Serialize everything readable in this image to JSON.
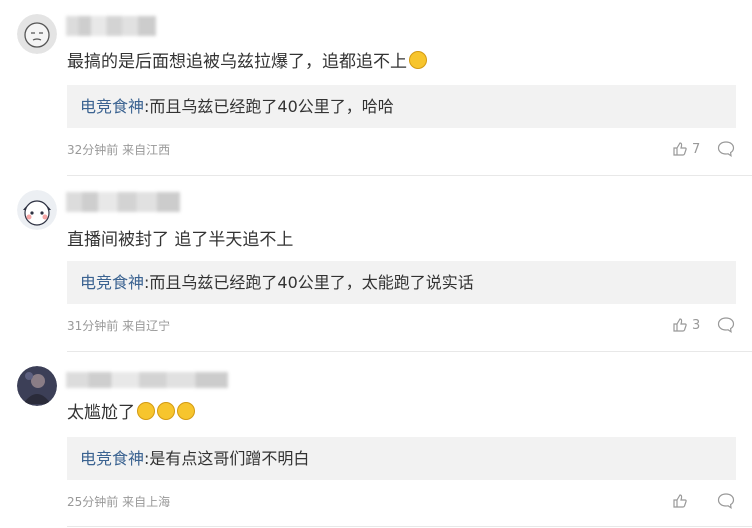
{
  "comments": [
    {
      "avatar_icon": "face-sketch-icon",
      "text": "最搞的是后面想追被乌兹拉爆了，追都追不上",
      "emojis": [
        "doge-emoji"
      ],
      "reply": {
        "name": "电竞食神",
        "text": ":而且乌兹已经跑了40公里了，哈哈"
      },
      "meta": "32分钟前 来自江西",
      "likes": "7"
    },
    {
      "avatar_icon": "cartoon-face-icon",
      "text": "直播间被封了 追了半天追不上",
      "emojis": [],
      "reply": {
        "name": "电竞食神",
        "text": ":而且乌兹已经跑了40公里了，太能跑了说实话"
      },
      "meta": "31分钟前 来自辽宁",
      "likes": "3"
    },
    {
      "avatar_icon": "photo-avatar-icon",
      "text": "太尴尬了",
      "emojis": [
        "laugh-cry-emoji",
        "laugh-cry-emoji",
        "laugh-cry-emoji"
      ],
      "reply": {
        "name": "电竞食神",
        "text": ":是有点这哥们蹭不明白"
      },
      "meta": "25分钟前 来自上海",
      "likes": ""
    }
  ],
  "colors": {
    "reply_name": "#3b6391",
    "meta": "#999999",
    "reply_bg": "#f2f2f2"
  }
}
